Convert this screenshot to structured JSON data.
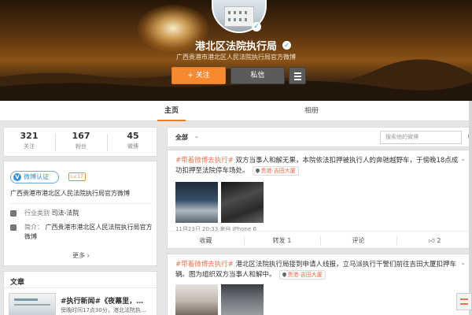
{
  "profile": {
    "name": "港北区法院执行局",
    "description": "广西贵港市港北区人民法院执行局官方微博",
    "follow_label": "+ 关注",
    "message_label": "私信"
  },
  "tabs": [
    {
      "label": "主页",
      "active": true
    },
    {
      "label": "相册",
      "active": false
    }
  ],
  "stats": [
    {
      "count": "321",
      "label": "关注"
    },
    {
      "count": "167",
      "label": "粉丝"
    },
    {
      "count": "45",
      "label": "微博"
    }
  ],
  "info": {
    "verified_label": "微博认证",
    "level_badge": "Lv.17",
    "verified_desc": "广西贵港市港北区人民法院执行局官方微博",
    "industry_label": "行业类别",
    "industry_value": "司法-法院",
    "bio_label": "简介：",
    "bio_value": "广西贵港市港北区人民法院执行局官方微博",
    "more_label": "更多 ›"
  },
  "articles": {
    "title": "文章",
    "item_title": "#执行新闻#《夜幕里，…",
    "item_meta": "傍晚时间17点30分，港北法院执…"
  },
  "feed": {
    "filter_label": "全部",
    "search_placeholder": "搜索他的微博",
    "posts": [
      {
        "topic": "#带着微博去执行#",
        "text": " 双方当事人和解无果，本院依法扣押被执行人的奔驰越野车，于傍晚18点成功扣押至法院停车场处。",
        "location": "贵港·吉田大厦",
        "meta": "11月23日 20:33 来自 iPhone 6",
        "actions": [
          "收藏",
          "转发 1",
          "评论",
          "2"
        ]
      },
      {
        "topic": "#带着微博去执行#",
        "text": " 港北区法院执行局接到申请人线报，立马派执行干警们前往吉田大厦扣押车辆。图为组织双方当事人和解中。",
        "location": "贵港·吉田大厦"
      }
    ]
  },
  "colors": {
    "accent": "#f7892e",
    "topic": "#eb7350",
    "verified": "#3b8fd4"
  }
}
